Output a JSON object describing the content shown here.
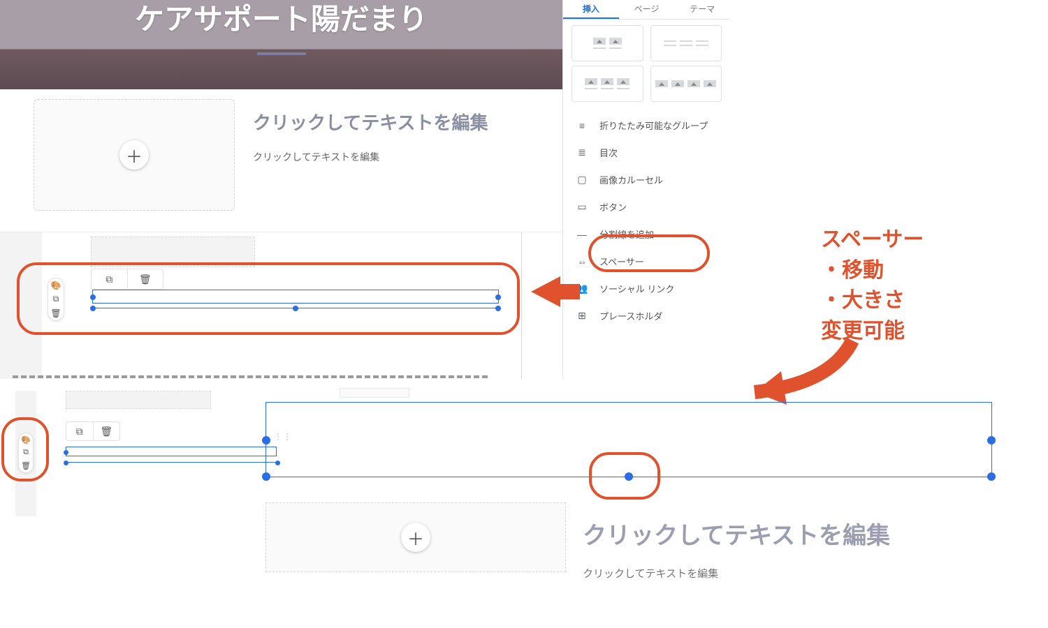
{
  "hero": {
    "title": "ケアサポート陽だまり"
  },
  "section1": {
    "heading": "クリックしてテキストを編集",
    "body": "クリックしてテキストを編集"
  },
  "tabs": {
    "insert": "挿入",
    "pages": "ページ",
    "theme": "テーマ"
  },
  "insertItems": {
    "collapsible": "折りたたみ可能なグループ",
    "toc": "目次",
    "carousel": "画像カルーセル",
    "button": "ボタン",
    "divider": "分割線を追加",
    "spacer": "スペーサー",
    "social": "ソーシャル リンク",
    "placeholder": "プレースホルダ"
  },
  "annotations": {
    "title": "スペーサー",
    "line1": "・移動",
    "line2": "・大きさ",
    "line3": "変更可能"
  },
  "bottom": {
    "heading": "クリックしてテキストを編集",
    "body": "クリックしてテキストを編集"
  },
  "icons": {
    "plus": "＋",
    "copy": "⧉",
    "trash": "🗑",
    "palette": "🎨",
    "toc": "≣",
    "carousel": "▢",
    "button": "▭",
    "divider": "—",
    "spacer": "⇔",
    "social": "👥",
    "placeholder": "⊞",
    "collapsible": "≡"
  }
}
